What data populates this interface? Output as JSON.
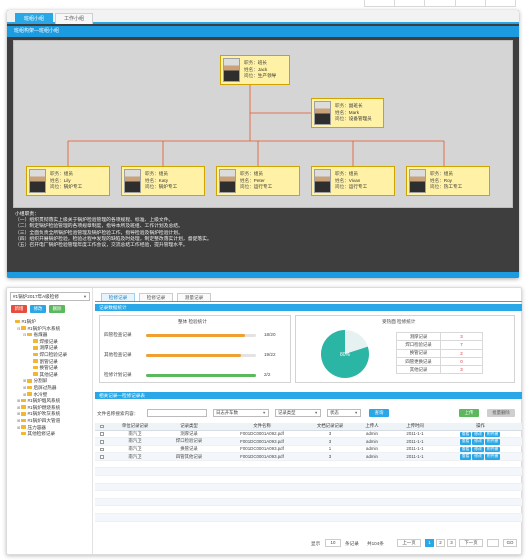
{
  "top": {
    "tabs": [
      "班组小组",
      "工作小组"
    ],
    "header": "班组构架—班组小组",
    "boss": {
      "role": "班长",
      "name": "Jack",
      "dept": "生产领导"
    },
    "mid": {
      "role": "副班长",
      "name": "Mark",
      "dept": "设备管理员"
    },
    "k_role": "职务：",
    "k_name": "姓名：",
    "k_dept": "岗位：",
    "members": [
      {
        "role": "组员",
        "name": "Lily",
        "dept": "锅炉专工"
      },
      {
        "role": "组员",
        "name": "Katy",
        "dept": "锅炉专工"
      },
      {
        "role": "组员",
        "name": "Peter",
        "dept": "运行专工"
      },
      {
        "role": "组员",
        "name": "Vivan",
        "dept": "运行专工"
      },
      {
        "role": "组员",
        "name": "Roy",
        "dept": "热工专工"
      }
    ],
    "notes_title": "小组职责：",
    "notes": [
      "（一）组织贯彻落实上级关于锅炉检验管理的各项规程、标准、上级文件。",
      "（二）制定锅炉检验管理的各项规章制度，指导本所及班组、工作计划及总结。",
      "（三）全面负责全所锅炉检验管理及锅炉检验工作，指导检验及锅炉检验计划。",
      "（四）组织开展锅炉检验，检验过程中发现的缺陷及时处理，制定整改落实计划，督促落实。",
      "（五）召开电厂锅炉检验管理年度工作会议，交流总结工作经验，提升管理水平。"
    ]
  },
  "left": {
    "select_value": "#1锅炉2017年A级检修",
    "buttons": [
      "新增",
      "修改",
      "删除"
    ],
    "tree": [
      {
        "level": 0,
        "label": "#1锅炉",
        "toggle": ""
      },
      {
        "level": 1,
        "label": "#1锅炉汽水系统",
        "toggle": "⊟"
      },
      {
        "level": 2,
        "label": "省煤器",
        "toggle": "⊟"
      },
      {
        "level": 3,
        "label": "焊接记录",
        "toggle": ""
      },
      {
        "level": 3,
        "label": "测厚记录",
        "toggle": ""
      },
      {
        "level": 3,
        "label": "焊口检验记录",
        "toggle": ""
      },
      {
        "level": 3,
        "label": "割管记录",
        "toggle": ""
      },
      {
        "level": 3,
        "label": "换管记录",
        "toggle": ""
      },
      {
        "level": 3,
        "label": "其他记录",
        "toggle": ""
      },
      {
        "level": 2,
        "label": "分割屏",
        "toggle": "⊞"
      },
      {
        "level": 2,
        "label": "后屏过热器",
        "toggle": "⊞"
      },
      {
        "level": 2,
        "label": "水冷壁",
        "toggle": "⊞"
      },
      {
        "level": 1,
        "label": "#1锅炉烟风系统",
        "toggle": "⊞"
      },
      {
        "level": 1,
        "label": "#1锅炉燃烧系统",
        "toggle": "⊞"
      },
      {
        "level": 1,
        "label": "#1锅炉吹灰系统",
        "toggle": "⊞"
      },
      {
        "level": 1,
        "label": "#1锅炉四大管道",
        "toggle": "⊞"
      },
      {
        "level": 1,
        "label": "压力容器",
        "toggle": "⊞"
      },
      {
        "level": 1,
        "label": "其他检修记录",
        "toggle": ""
      }
    ]
  },
  "right": {
    "tabs": [
      "检修记录",
      "检修记录",
      "测量记录"
    ],
    "stats_header": "记录数据统计",
    "progress_title": "整体  检验统计",
    "progress": [
      {
        "label": "四管检查记录",
        "value": "18/20",
        "frac": 0.9,
        "color": "#f0a030"
      },
      {
        "label": "其他检查记录",
        "value": "19/22",
        "frac": 0.86,
        "color": "#f0a030"
      },
      {
        "label": "检修计划记录",
        "value": "2/2",
        "frac": 1.0,
        "color": "#5cb85c"
      }
    ],
    "pie_title": "受热面  检修统计",
    "pie_pct": "80%",
    "pie_frac": 0.8,
    "counts": [
      {
        "label": "测厚记录",
        "value": "3"
      },
      {
        "label": "焊口检验记录",
        "value": "7"
      },
      {
        "label": "换管记录",
        "value": "2"
      },
      {
        "label": "四管更换记录",
        "value": "0"
      },
      {
        "label": "其他记录",
        "value": "3"
      }
    ],
    "list_header": "相关记录—检修记录表",
    "search_label": "文件名称搜索内容：",
    "filter1": "日志开车数",
    "filter2": "记录类型",
    "filter3": "状态",
    "search_btn": "查询",
    "upload_btn": "上传",
    "batch_btn": "批量删除",
    "columns": [
      "",
      "单位记录记录",
      "记录类型",
      "文件名称",
      "文档记录记录",
      "上传人",
      "上传时间",
      "操作"
    ],
    "rows": [
      {
        "unit": "南汽卫",
        "type": "测厚记录",
        "file": "F001DC0001A092.pdf",
        "num": "3",
        "user": "admin",
        "date": "2011-1-1"
      },
      {
        "unit": "南汽卫",
        "type": "焊口检验记录",
        "file": "F001DC0001A093.pdf",
        "num": "3",
        "user": "admin",
        "date": "2011-1-1"
      },
      {
        "unit": "南汽卫",
        "type": "换管记录",
        "file": "F001DC0001A093.pdf",
        "num": "1",
        "user": "admin",
        "date": "2011-1-1"
      },
      {
        "unit": "南汽卫",
        "type": "四管其他记录",
        "file": "F001DC0001A093.pdf",
        "num": "3",
        "user": "admin",
        "date": "2011-1-1"
      }
    ],
    "row_ops": [
      "查看",
      "修改",
      "附件删"
    ],
    "pager": {
      "per_page_label": "显示",
      "per_page": "10",
      "unit": "条记录",
      "total": "共104条",
      "prev": "上一页",
      "pages": [
        "1",
        "2",
        "3"
      ],
      "next": "下一页",
      "go": "GO"
    }
  },
  "colors": {
    "accent": "#2aa7e6",
    "header": "#1d9be0",
    "card": "#fff2a6",
    "line": "#e5532a"
  }
}
